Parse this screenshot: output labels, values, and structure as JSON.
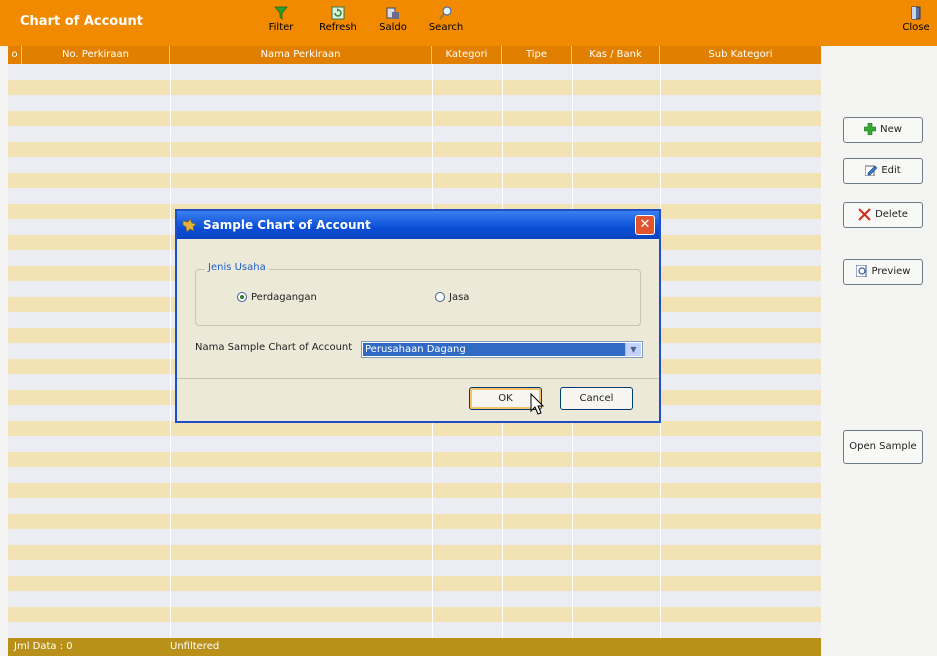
{
  "app": {
    "title": "Chart of Account"
  },
  "toolbar": {
    "filter_label": "Filter",
    "refresh_label": "Refresh",
    "saldo_label": "Saldo",
    "search_label": "Search",
    "close_label": "Close"
  },
  "grid": {
    "columns": [
      "o",
      "No. Perkiraan",
      "Nama Perkiraan",
      "Kategori",
      "Tipe",
      "Kas / Bank",
      "Sub Kategori"
    ],
    "footer": {
      "count": "Jml Data : 0",
      "filter_status": "Unfiltered"
    }
  },
  "side": {
    "new_label": "New",
    "edit_label": "Edit",
    "delete_label": "Delete",
    "preview_label": "Preview",
    "open_sample_label": "Open Sample"
  },
  "dialog": {
    "title": "Sample Chart of Account",
    "close_glyph": "✕",
    "group_label": "Jenis Usaha",
    "radio_1": "Perdagangan",
    "radio_2": "Jasa",
    "radio_selected": "Perdagangan",
    "name_label": "Nama Sample Chart of Account",
    "name_value": "Perusahaan Dagang",
    "ok_label": "OK",
    "cancel_label": "Cancel"
  },
  "colors": {
    "topbar": "#f28a00",
    "row_alt": "#f3e3b4",
    "row_plain": "#ecedf2",
    "footer": "#b8901a",
    "dialog_title": "#0a4ed6"
  },
  "icons": [
    "funnel-icon",
    "refresh-icon",
    "saldo-icon",
    "search-icon",
    "close-door-icon",
    "plus-icon",
    "pencil-icon",
    "x-icon",
    "preview-icon",
    "key-icon"
  ]
}
